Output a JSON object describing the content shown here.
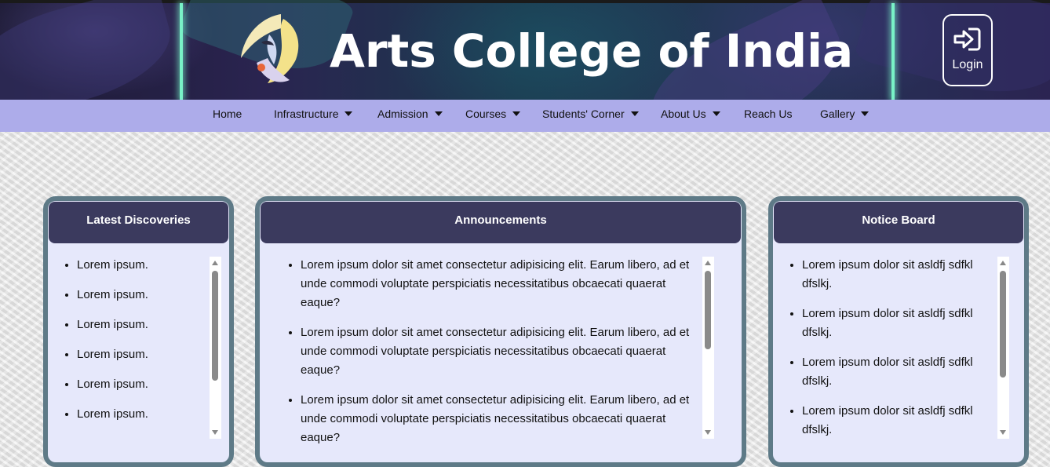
{
  "site": {
    "title": "Arts College of India",
    "login_label": "Login"
  },
  "nav": {
    "items": [
      {
        "label": "Home",
        "dropdown": false
      },
      {
        "label": "Infrastructure",
        "dropdown": true
      },
      {
        "label": "Admission",
        "dropdown": true
      },
      {
        "label": "Courses",
        "dropdown": true
      },
      {
        "label": "Students' Corner",
        "dropdown": true
      },
      {
        "label": "About Us",
        "dropdown": true
      },
      {
        "label": "Reach Us",
        "dropdown": false
      },
      {
        "label": "Gallery",
        "dropdown": true
      }
    ]
  },
  "panels": {
    "discoveries": {
      "title": "Latest Discoveries",
      "items": [
        "Lorem ipsum.",
        "Lorem ipsum.",
        "Lorem ipsum.",
        "Lorem ipsum.",
        "Lorem ipsum.",
        "Lorem ipsum."
      ]
    },
    "announcements": {
      "title": "Announcements",
      "items": [
        "Lorem ipsum dolor sit amet consectetur adipisicing elit. Earum libero, ad et unde commodi voluptate perspiciatis necessitatibus obcaecati quaerat eaque?",
        "Lorem ipsum dolor sit amet consectetur adipisicing elit. Earum libero, ad et unde commodi voluptate perspiciatis necessitatibus obcaecati quaerat eaque?",
        "Lorem ipsum dolor sit amet consectetur adipisicing elit. Earum libero, ad et unde commodi voluptate perspiciatis necessitatibus obcaecati quaerat eaque?"
      ]
    },
    "notices": {
      "title": "Notice Board",
      "items": [
        "Lorem ipsum dolor sit asldfj sdfkl dfslkj.",
        "Lorem ipsum dolor sit asldfj sdfkl dfslkj.",
        "Lorem ipsum dolor sit asldfj sdfkl dfslkj.",
        "Lorem ipsum dolor sit asldfj sdfkl dfslkj."
      ]
    }
  },
  "icons": {
    "login": "sign-in-icon",
    "logo": "college-logo"
  },
  "colors": {
    "nav_bg": "#adacea",
    "panel_head": "#3b3a5e",
    "panel_border": "#5e7a87",
    "panel_body": "#e6e8fb"
  }
}
